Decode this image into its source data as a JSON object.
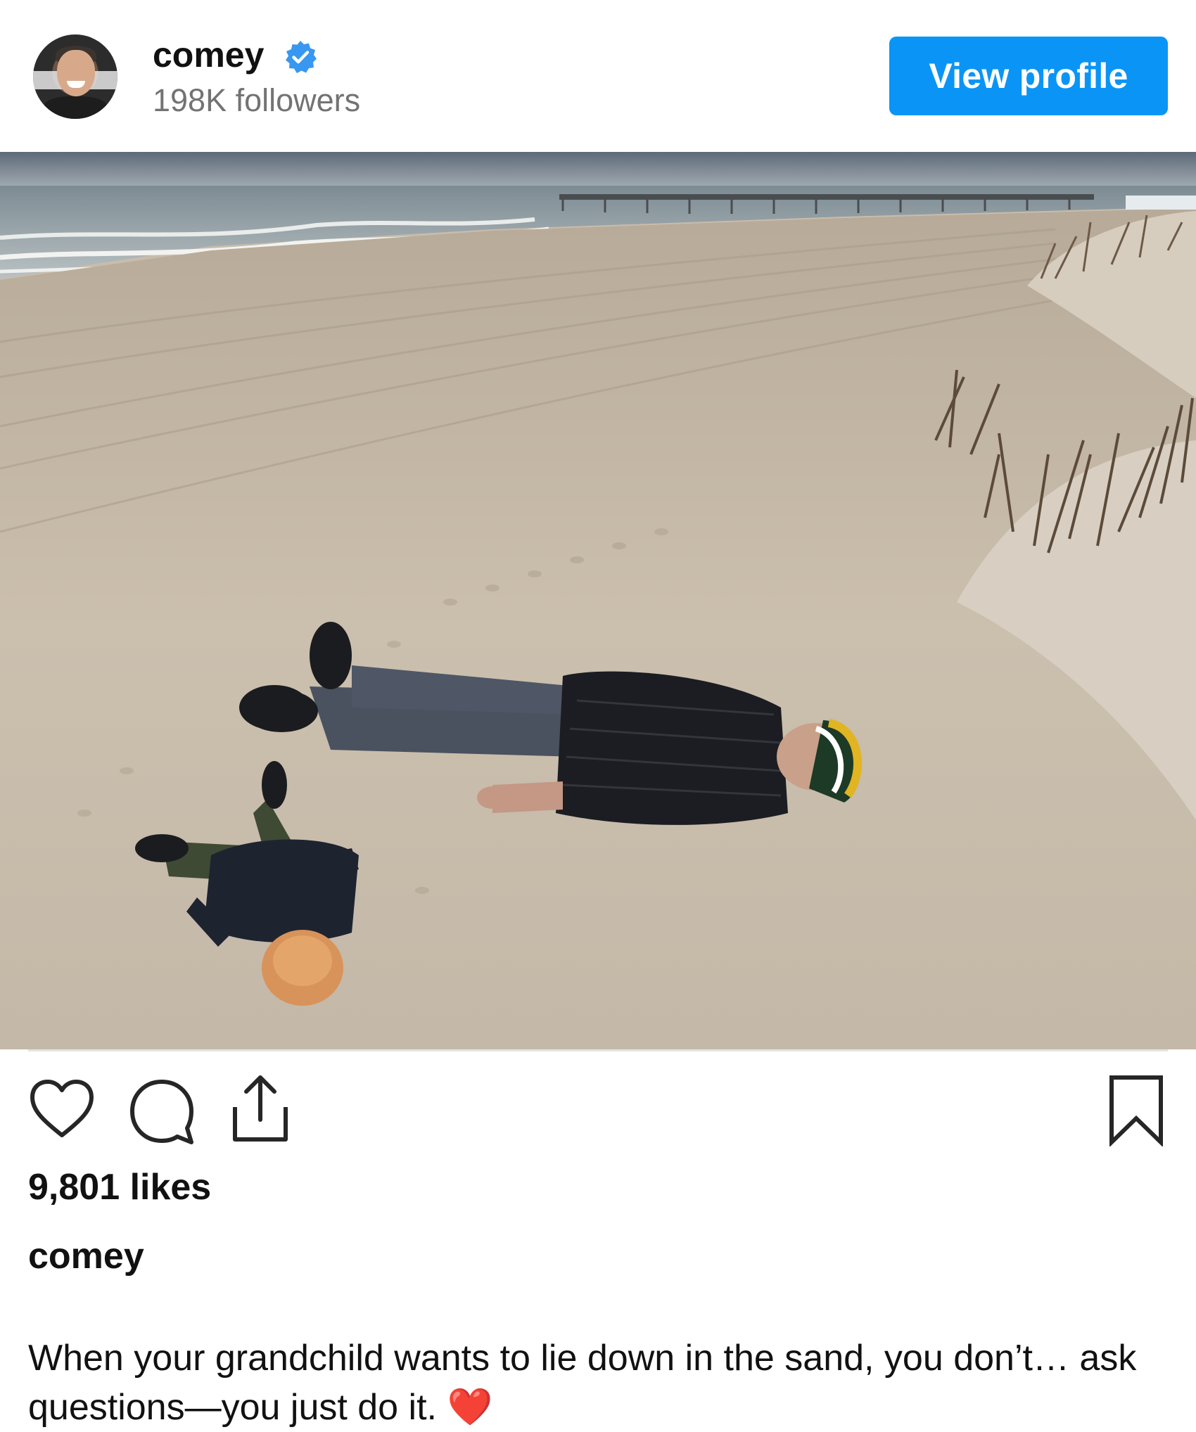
{
  "header": {
    "username": "comey",
    "followers": "198K followers",
    "view_profile_label": "View profile",
    "verified_badge_color": "#3897f0",
    "button_color": "#0a95f6"
  },
  "post": {
    "image_icon": "photo",
    "likes": "9,801 likes",
    "caption_username": "comey",
    "caption_text": "When your grandchild wants to lie down in the sand, you don’t… ask questions—you just do it.",
    "caption_emoji": "❤️"
  },
  "actions": {
    "like": "heart-icon",
    "comment": "comment-bubble-icon",
    "share": "share-icon",
    "save": "bookmark-icon"
  }
}
